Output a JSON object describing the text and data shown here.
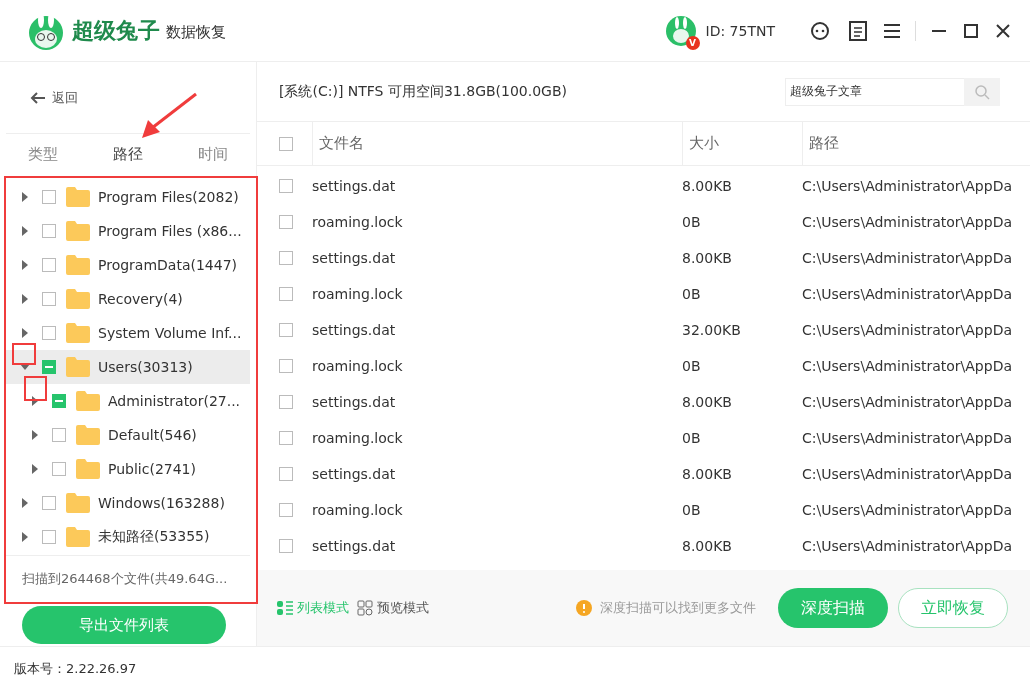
{
  "app": {
    "brand": "超级兔子",
    "product": "数据恢复",
    "user_id": "ID: 75TNT",
    "vip_badge": "V"
  },
  "sidebar": {
    "back": "返回",
    "tabs": [
      {
        "label": "类型",
        "selected": false
      },
      {
        "label": "路径",
        "selected": true
      },
      {
        "label": "时间",
        "selected": false
      }
    ],
    "tree": [
      {
        "label": "Program Files(2082)",
        "expanded": false,
        "partial": false,
        "selected": false
      },
      {
        "label": "Program Files (x86...",
        "expanded": false,
        "partial": false,
        "selected": false
      },
      {
        "label": "ProgramData(1447)",
        "expanded": false,
        "partial": false,
        "selected": false
      },
      {
        "label": "Recovery(4)",
        "expanded": false,
        "partial": false,
        "selected": false
      },
      {
        "label": "System Volume Inf...",
        "expanded": false,
        "partial": false,
        "selected": false
      },
      {
        "label": "Users(30313)",
        "expanded": true,
        "partial": true,
        "selected": true,
        "children": [
          {
            "label": "Administrator(27...",
            "expanded": false,
            "partial": true,
            "selected": false
          },
          {
            "label": "Default(546)",
            "expanded": false,
            "partial": false,
            "selected": false
          },
          {
            "label": "Public(2741)",
            "expanded": false,
            "partial": false,
            "selected": false
          }
        ]
      },
      {
        "label": "Windows(163288)",
        "expanded": false,
        "partial": false,
        "selected": false
      },
      {
        "label": "未知路径(53355)",
        "expanded": false,
        "partial": false,
        "selected": false
      }
    ],
    "summary": "扫描到264468个文件(共49.64G...",
    "export_button": "导出文件列表"
  },
  "drive_info": "[系统(C:)] NTFS 可用空间31.8GB(100.0GB)",
  "search": {
    "value": "超级兔子文章"
  },
  "table": {
    "select_all_checked": false,
    "columns": [
      "文件名",
      "大小",
      "路径"
    ],
    "rows": [
      {
        "name": "settings.dat",
        "size": "8.00KB",
        "path": "C:\\Users\\Administrator\\AppDa",
        "checked": false
      },
      {
        "name": "roaming.lock",
        "size": "0B",
        "path": "C:\\Users\\Administrator\\AppDa",
        "checked": false
      },
      {
        "name": "settings.dat",
        "size": "8.00KB",
        "path": "C:\\Users\\Administrator\\AppDa",
        "checked": false
      },
      {
        "name": "roaming.lock",
        "size": "0B",
        "path": "C:\\Users\\Administrator\\AppDa",
        "checked": false
      },
      {
        "name": "settings.dat",
        "size": "32.00KB",
        "path": "C:\\Users\\Administrator\\AppDa",
        "checked": false
      },
      {
        "name": "roaming.lock",
        "size": "0B",
        "path": "C:\\Users\\Administrator\\AppDa",
        "checked": false
      },
      {
        "name": "settings.dat",
        "size": "8.00KB",
        "path": "C:\\Users\\Administrator\\AppDa",
        "checked": false
      },
      {
        "name": "roaming.lock",
        "size": "0B",
        "path": "C:\\Users\\Administrator\\AppDa",
        "checked": false
      },
      {
        "name": "settings.dat",
        "size": "8.00KB",
        "path": "C:\\Users\\Administrator\\AppDa",
        "checked": false
      },
      {
        "name": "roaming.lock",
        "size": "0B",
        "path": "C:\\Users\\Administrator\\AppDa",
        "checked": false
      },
      {
        "name": "settings.dat",
        "size": "8.00KB",
        "path": "C:\\Users\\Administrator\\AppDa",
        "checked": false
      }
    ]
  },
  "view_modes": [
    {
      "label": "列表模式",
      "selected": true
    },
    {
      "label": "预览模式",
      "selected": false
    }
  ],
  "hint": "深度扫描可以找到更多文件",
  "deep_scan_button": "深度扫描",
  "recover_button": "立即恢复",
  "version": "版本号：2.22.26.97"
}
